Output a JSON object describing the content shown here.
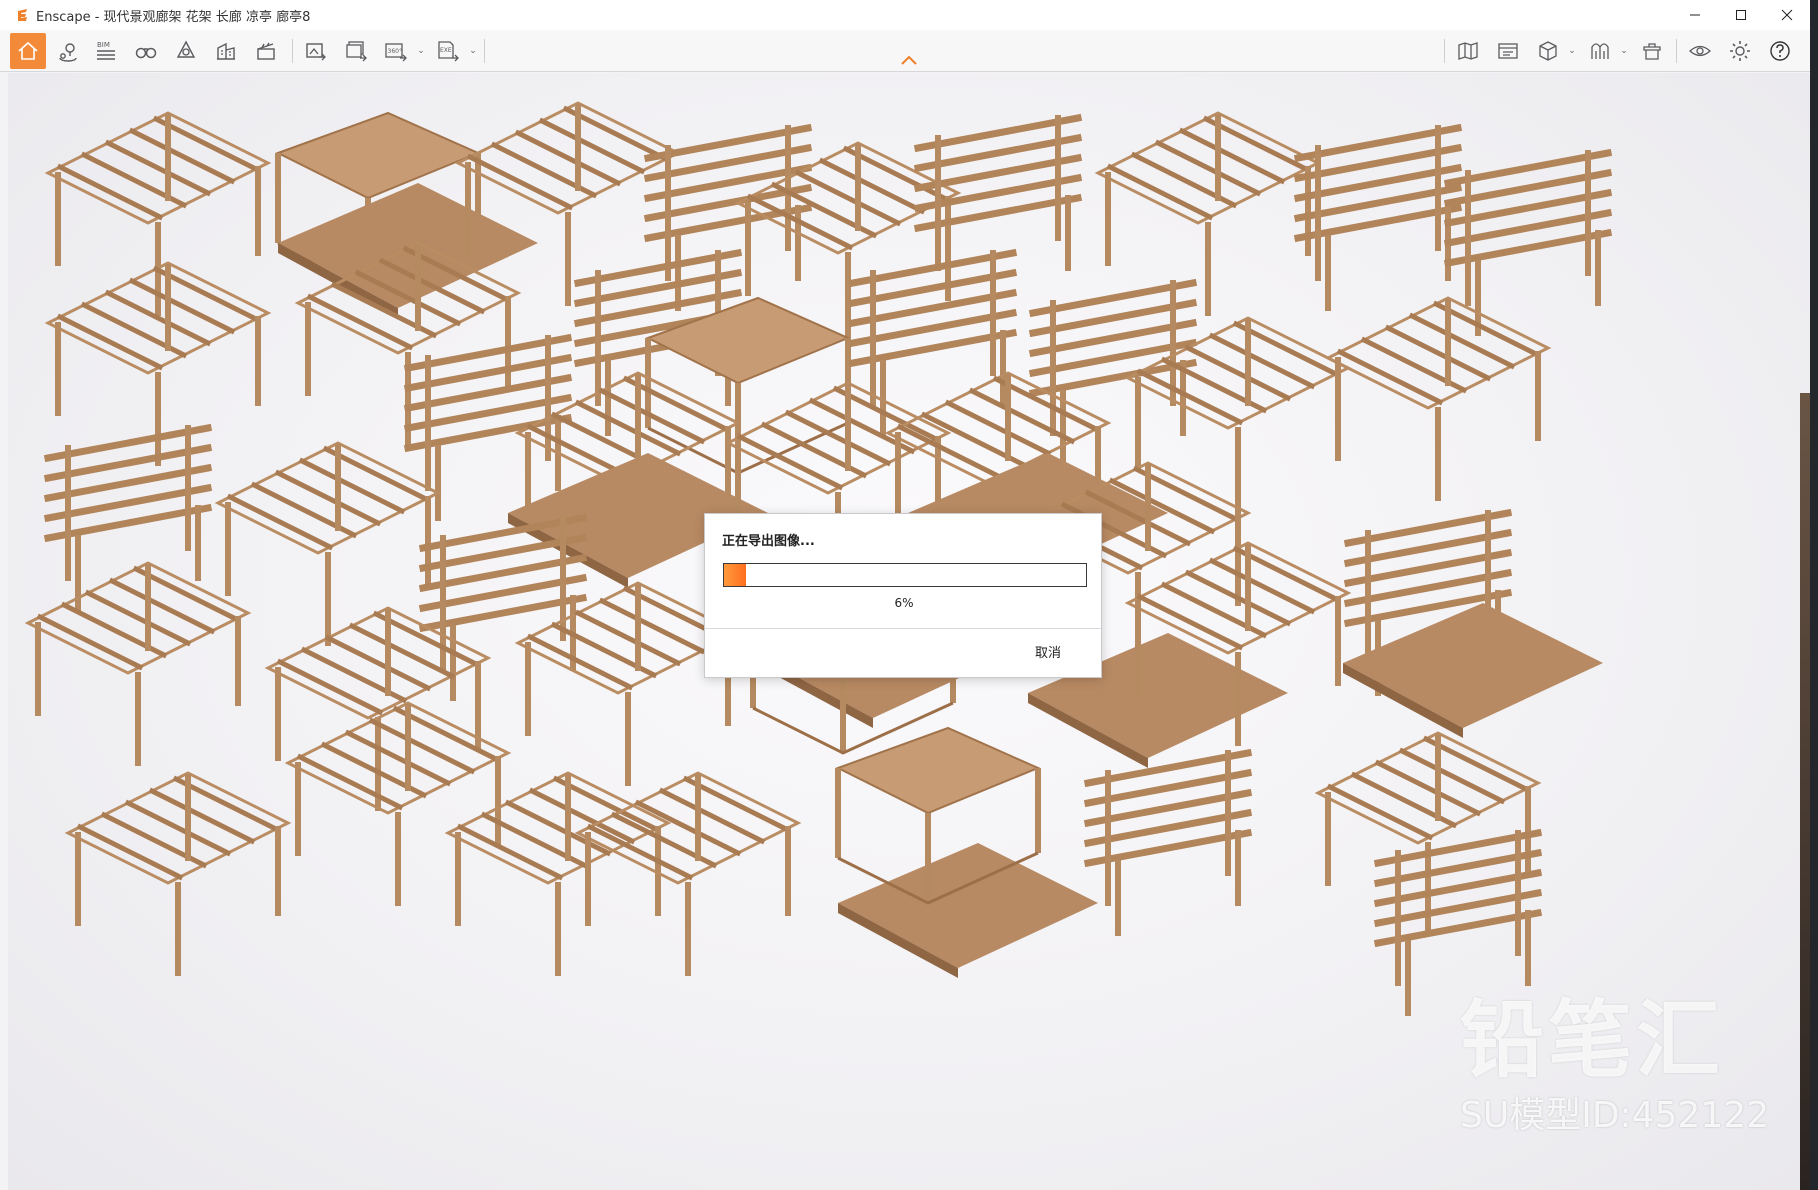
{
  "window": {
    "title": "Enscape - 现代景观廊架 花架 长廊 凉亭 廊亭8",
    "controls": [
      "minimize",
      "maximize",
      "close"
    ]
  },
  "toolbar": {
    "bim_label": "BIM",
    "pano_label": "360°",
    "exe_label": "EXE",
    "left_icons": [
      "home-icon",
      "location-pin-icon",
      "bim-icon",
      "binoculars-icon",
      "atmosphere-icon",
      "building-icon",
      "clapperboard-icon",
      "screenshot-export-icon",
      "batch-render-icon",
      "panorama-icon",
      "exe-export-icon"
    ],
    "right_icons": [
      "map-icon",
      "video-editor-icon",
      "cube-icon",
      "material-icon",
      "asset-library-icon",
      "visual-settings-icon",
      "settings-gear-icon",
      "help-icon"
    ]
  },
  "dialog": {
    "title": "正在导出图像...",
    "progress_percent": 6,
    "progress_label": "6%",
    "cancel_label": "取消"
  },
  "watermark": {
    "brand": "铅笔汇",
    "model_id": "SU模型ID:452122"
  }
}
